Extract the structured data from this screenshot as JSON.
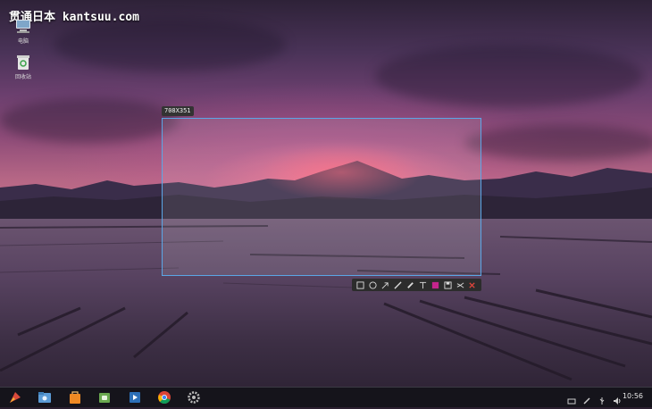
{
  "watermark": "贯通日本 kantsuu.com",
  "desktop": {
    "icons": [
      {
        "name": "computer",
        "label": "电脑"
      },
      {
        "name": "trash",
        "label": "回收站"
      }
    ]
  },
  "screenshot_tool": {
    "size_label": "708X351",
    "tools": [
      "rectangle",
      "ellipse",
      "arrow",
      "pen",
      "mosaic",
      "text",
      "color",
      "save",
      "share",
      "close"
    ],
    "selected_color": "#c4248c"
  },
  "taskbar": {
    "apps": [
      "launcher",
      "file-manager",
      "store",
      "android-app",
      "video-player",
      "chrome",
      "settings"
    ],
    "clock": "10:56"
  },
  "colors": {
    "selection_border": "#5aa6e6",
    "close_red": "#e0463c"
  }
}
